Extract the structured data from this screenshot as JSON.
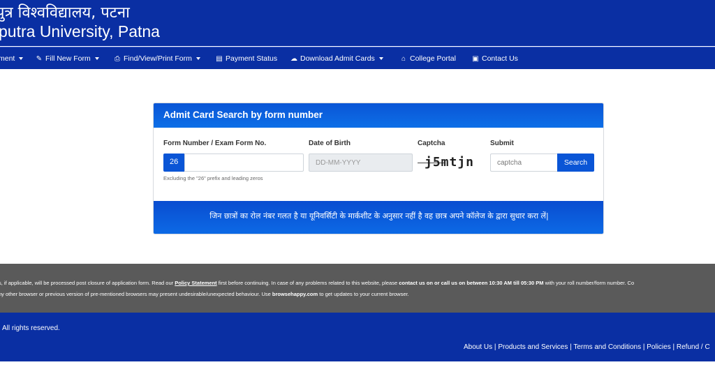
{
  "header": {
    "title_hindi": "पुत्र विश्वविद्यालय, पटना",
    "title_english": "putra University, Patna"
  },
  "nav": {
    "items": [
      {
        "label": "ment",
        "icon": "",
        "dropdown": true
      },
      {
        "label": "Fill New Form",
        "icon": "edit-icon",
        "dropdown": true
      },
      {
        "label": "Find/View/Print Form",
        "icon": "print-icon",
        "dropdown": true
      },
      {
        "label": "Payment Status",
        "icon": "document-icon",
        "dropdown": false
      },
      {
        "label": "Download Admit Cards",
        "icon": "cloud-download-icon",
        "dropdown": true
      },
      {
        "label": "College Portal",
        "icon": "institution-icon",
        "dropdown": false
      },
      {
        "label": "Contact Us",
        "icon": "contact-card-icon",
        "dropdown": false
      }
    ]
  },
  "card": {
    "title": "Admit Card Search by form number",
    "form_label": "Form Number / Exam Form No.",
    "form_prefix": "26",
    "form_value": "",
    "help_text": "Excluding the \"26\" prefix and leading zeros",
    "dob_label": "Date of Birth",
    "dob_placeholder": "DD-MM-YYYY",
    "captcha_label": "Captcha",
    "captcha_text": "j5mtjn",
    "submit_label": "Submit",
    "captcha_placeholder": "captcha",
    "search_button": "Search",
    "notice": "जिन छात्रों का रोल नंबर गलत है या यूनिवर्सिटी के मार्कशीट के अनुसार नहीं है वह छात्र अपने कॉलेज के द्वारा सुधार करा लें|"
  },
  "footer_notice": {
    "line1_a": "s, if applicable, will be processed post closure of application form. Read our ",
    "line1_link": "Policy Statement",
    "line1_b": " first before continuing. In case of any problems related to this website, please ",
    "line1_bold": "contact us on or call us on between 10:30 AM till 05:30 PM",
    "line1_c": " with your roll number/form number. Co",
    "line2_a": "ny other browser or previous version of pre-mentioned browsers may present undesirable/unexpected behaviour. Use ",
    "line2_bold": "browsehappy.com",
    "line2_b": " to get updates to your current browser."
  },
  "footer": {
    "copyright": "All rights reserved.",
    "links": [
      "About Us",
      "Products and Services",
      "Terms and Conditions",
      "Policies",
      "Refund / C"
    ]
  },
  "colors": {
    "header_blue": "#0a2fa3",
    "accent_blue": "#0a55d6",
    "footer_grey": "#5a5a5a"
  }
}
